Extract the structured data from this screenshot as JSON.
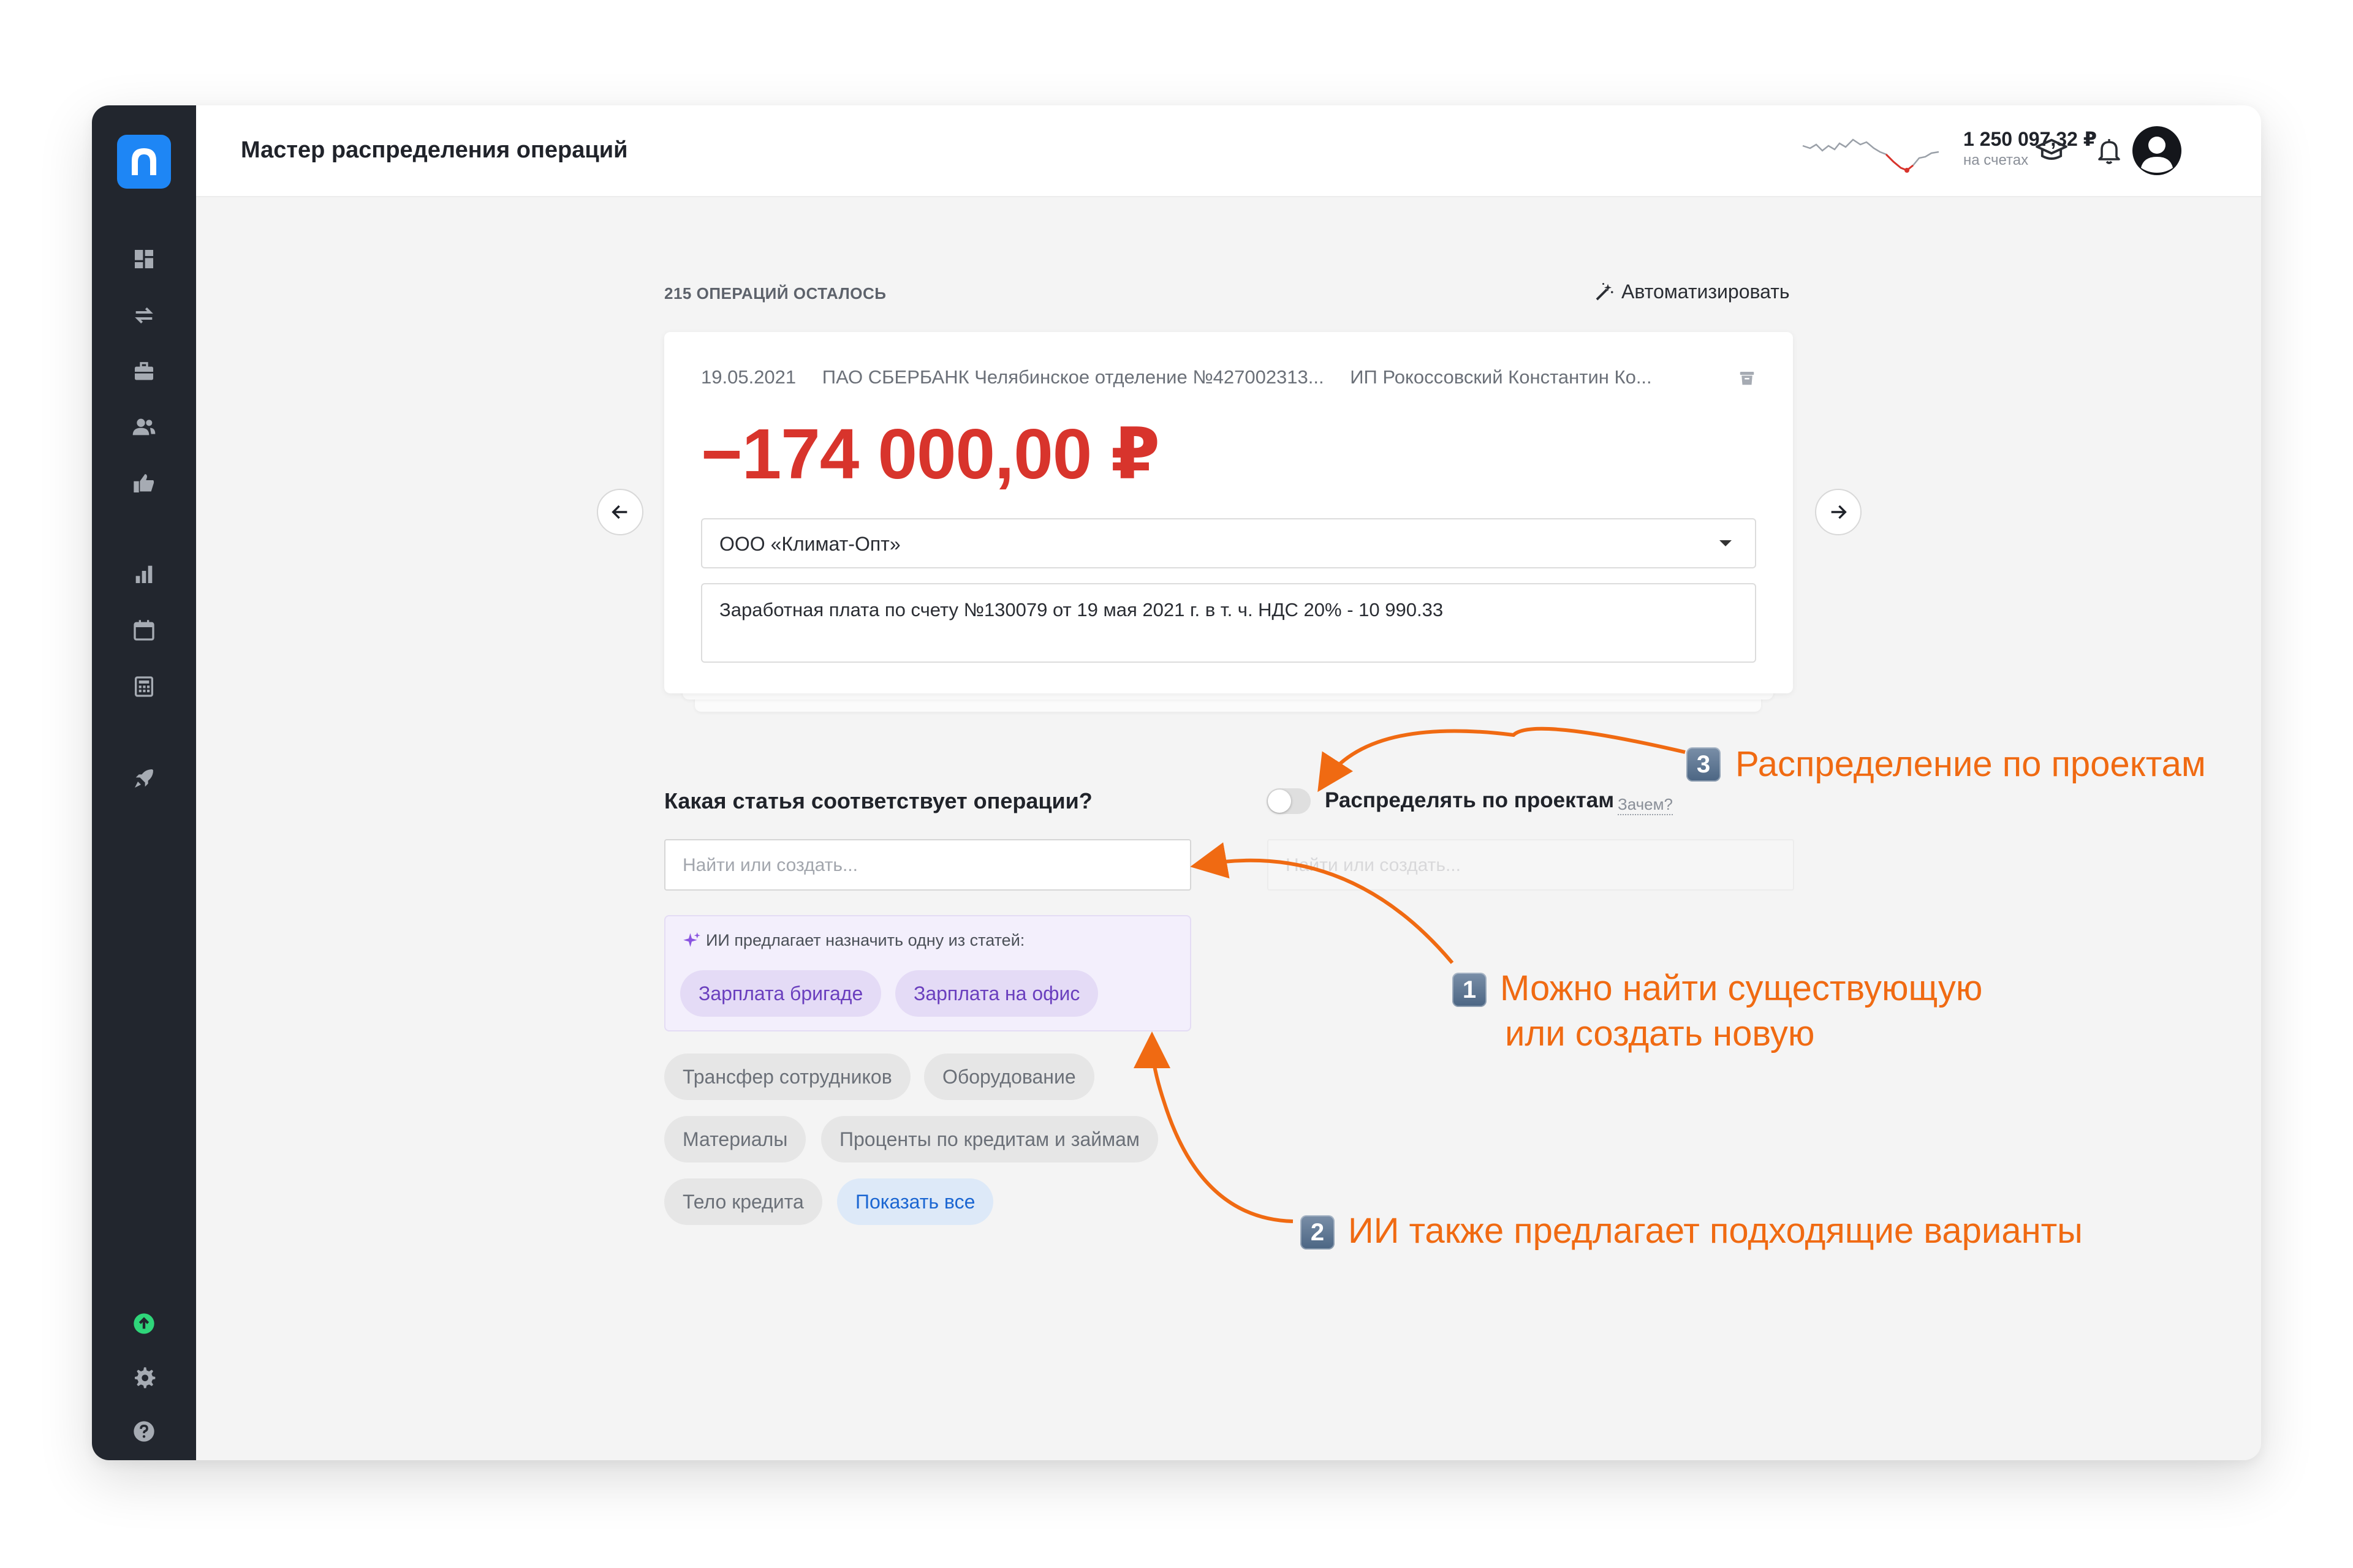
{
  "header": {
    "title": "Мастер распределения операций",
    "balance_amount": "1 250 097,32 ₽",
    "balance_label": "на счетах"
  },
  "wizard": {
    "remaining": "215 ОПЕРАЦИЙ ОСТАЛОСЬ",
    "automate_label": "Автоматизировать"
  },
  "operation": {
    "date": "19.05.2021",
    "bank": "ПАО СБЕРБАНК Челябинское отделение №427002313...",
    "counterparty": "ИП Рокоссовский Константин Ко...",
    "amount": "−174 000,00 ₽",
    "contractor": "ООО «Климат-Опт»",
    "purpose": "Заработная плата по счету №130079 от 19 мая 2021 г. в т. ч. НДС 20% - 10 990.33"
  },
  "category": {
    "question": "Какая статья соответствует операции?",
    "search_placeholder": "Найти или создать...",
    "ai_title": "ИИ предлагает назначить одну из статей:",
    "ai_suggestions": [
      "Зарплата бригаде",
      "Зарплата на офис"
    ],
    "chips": [
      "Трансфер сотрудников",
      "Оборудование",
      "Материалы",
      "Проценты по кредитам и займам",
      "Тело кредита"
    ],
    "show_all": "Показать все"
  },
  "projects": {
    "toggle_label": "Распределять по проектам",
    "toggle_on": false,
    "why_link": "Зачем?",
    "search_placeholder": "Найти или создать..."
  },
  "annotations": [
    {
      "number": "3",
      "text": "Распределение по проектам"
    },
    {
      "number": "1",
      "line1": "Можно найти существующую",
      "line2": "или создать новую"
    },
    {
      "number": "2",
      "text": "ИИ также предлагает подходящие варианты"
    }
  ],
  "colors": {
    "sidebar": "#22262e",
    "accent": "#1e86f5",
    "amount_negative": "#d8342c",
    "annotation": "#f06a12",
    "ai_chip_text": "#6a3fbe",
    "link_blue": "#1b66d2"
  },
  "icons": {
    "sidebar": [
      "dashboard-icon",
      "transfer-icon",
      "briefcase-icon",
      "users-icon",
      "thumb-up-icon",
      "bar-chart-icon",
      "calendar-icon",
      "calculator-icon",
      "rocket-icon",
      "upload-icon",
      "gear-icon",
      "help-icon"
    ],
    "header": [
      "graduation-cap-icon",
      "bell-icon",
      "user-avatar-icon"
    ]
  }
}
